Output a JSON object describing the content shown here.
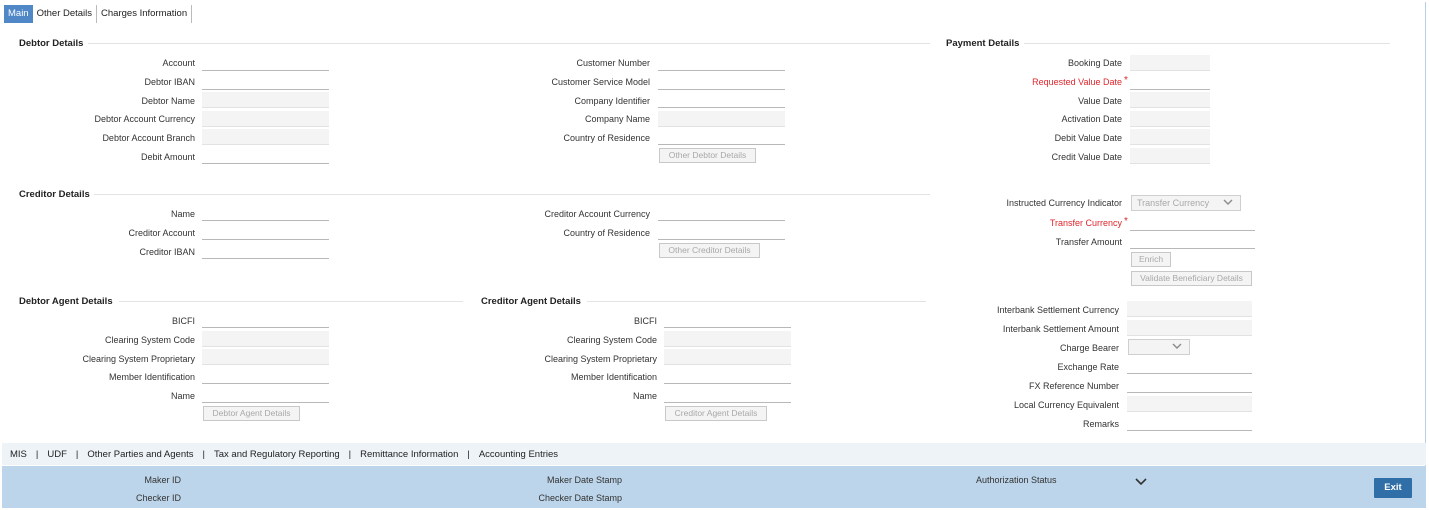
{
  "tabs": [
    "Main",
    "Other Details",
    "Charges Information"
  ],
  "debtor": {
    "title": "Debtor Details",
    "left": [
      "Account",
      "Debtor IBAN",
      "Debtor Name",
      "Debtor Account Currency",
      "Debtor Account Branch",
      "Debit Amount"
    ],
    "right": [
      "Customer Number",
      "Customer Service Model",
      "Company Identifier",
      "Company Name",
      "Country of Residence"
    ],
    "button": "Other Debtor Details"
  },
  "creditor": {
    "title": "Creditor Details",
    "left": [
      "Name",
      "Creditor Account",
      "Creditor IBAN"
    ],
    "right": [
      "Creditor Account Currency",
      "Country of Residence"
    ],
    "button": "Other Creditor Details"
  },
  "debtor_agent": {
    "title": "Debtor Agent Details",
    "labels": [
      "BICFI",
      "Clearing System Code",
      "Clearing System Proprietary",
      "Member Identification",
      "Name"
    ],
    "button": "Debtor Agent Details"
  },
  "creditor_agent": {
    "title": "Creditor Agent Details",
    "labels": [
      "BICFI",
      "Clearing System Code",
      "Clearing System Proprietary",
      "Member Identification",
      "Name"
    ],
    "button": "Creditor Agent Details"
  },
  "payment": {
    "title": "Payment Details",
    "dates": [
      "Booking Date",
      "Requested Value Date",
      "Value Date",
      "Activation Date",
      "Debit Value Date",
      "Credit Value Date"
    ],
    "instructed_currency_indicator": "Instructed Currency Indicator",
    "instructed_currency_value": "Transfer Currency",
    "transfer_currency": "Transfer Currency",
    "transfer_amount": "Transfer Amount",
    "enrich": "Enrich",
    "validate": "Validate Beneficiary Details",
    "settlement": [
      "Interbank Settlement Currency",
      "Interbank Settlement Amount",
      "Charge Bearer",
      "Exchange Rate",
      "FX Reference Number",
      "Local Currency Equivalent",
      "Remarks"
    ],
    "required_mark": "*"
  },
  "bottom_links": [
    "MIS",
    "UDF",
    "Other Parties and Agents",
    "Tax and Regulatory Reporting",
    "Remittance Information",
    "Accounting Entries"
  ],
  "bottom_sep": "|",
  "footer": {
    "maker_id": "Maker ID",
    "checker_id": "Checker ID",
    "maker_date": "Maker Date Stamp",
    "checker_date": "Checker Date Stamp",
    "auth_status": "Authorization Status",
    "exit": "Exit"
  },
  "colors": {
    "tab_active": "#4f87c7",
    "required": "#e0262d",
    "footer": "#bcd5ea",
    "exit_button": "#2f6ea7"
  },
  "icons": {
    "dropdown": "chevron-down-icon"
  }
}
